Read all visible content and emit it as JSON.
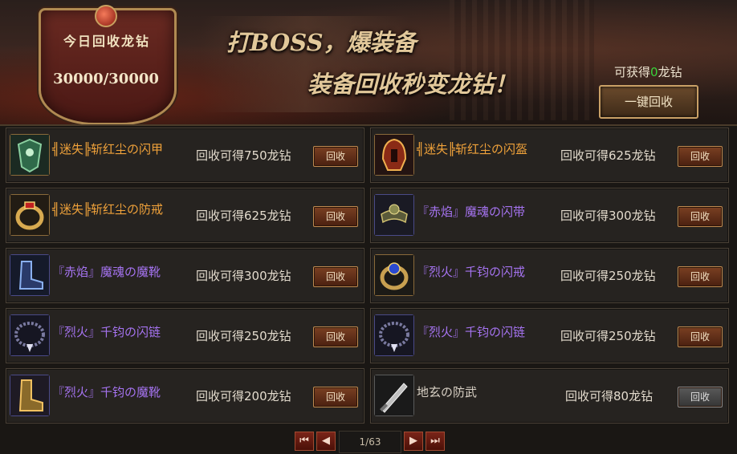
{
  "banner": {
    "quota_title": "今日回收龙钻",
    "quota_value": "30000/30000",
    "slogan_line1": "打BOSS，爆装备",
    "slogan_line2": "装备回收秒变龙钻！",
    "gain_prefix": "可获得",
    "gain_amount": "0",
    "gain_suffix": "龙钻",
    "recycle_all_label": "一键回收"
  },
  "items": [
    {
      "name": "╣迷失╠斩红尘の闪甲",
      "reward": "回收可得750龙钻",
      "button": "回收",
      "quality": "orange",
      "icon": "armor-icon"
    },
    {
      "name": "╣迷失╠斩红尘の闪盔",
      "reward": "回收可得625龙钻",
      "button": "回收",
      "quality": "orange",
      "icon": "helmet-icon"
    },
    {
      "name": "╣迷失╠斩红尘の防戒",
      "reward": "回收可得625龙钻",
      "button": "回收",
      "quality": "orange",
      "icon": "ring-icon"
    },
    {
      "name": "『赤焰』魔魂の闪带",
      "reward": "回收可得300龙钻",
      "button": "回收",
      "quality": "purple",
      "icon": "belt-icon"
    },
    {
      "name": "『赤焰』魔魂の魔靴",
      "reward": "回收可得300龙钻",
      "button": "回收",
      "quality": "purple",
      "icon": "boots-icon"
    },
    {
      "name": "『烈火』千钧の闪戒",
      "reward": "回收可得250龙钻",
      "button": "回收",
      "quality": "purple",
      "icon": "ring-icon"
    },
    {
      "name": "『烈火』千钧の闪链",
      "reward": "回收可得250龙钻",
      "button": "回收",
      "quality": "purple",
      "icon": "necklace-icon"
    },
    {
      "name": "『烈火』千钧の闪链",
      "reward": "回收可得250龙钻",
      "button": "回收",
      "quality": "purple",
      "icon": "necklace-icon"
    },
    {
      "name": "『烈火』千钧の魔靴",
      "reward": "回收可得200龙钻",
      "button": "回收",
      "quality": "purple",
      "icon": "boots-icon"
    },
    {
      "name": "地玄の防武",
      "reward": "回收可得80龙钻",
      "button": "回收",
      "quality": "white",
      "icon": "sword-icon"
    }
  ],
  "pagination": {
    "first_symbol": "⏮",
    "prev_symbol": "◀",
    "page_display": "1/63",
    "next_symbol": "▶",
    "last_symbol": "⏭"
  },
  "colors": {
    "orange_item": "#f0a23a",
    "purple_item": "#a573f0",
    "white_item": "#d8d0c4",
    "gain_number": "#39d23a",
    "button_red": "#7a4022",
    "frame_gold": "#c9a066"
  }
}
